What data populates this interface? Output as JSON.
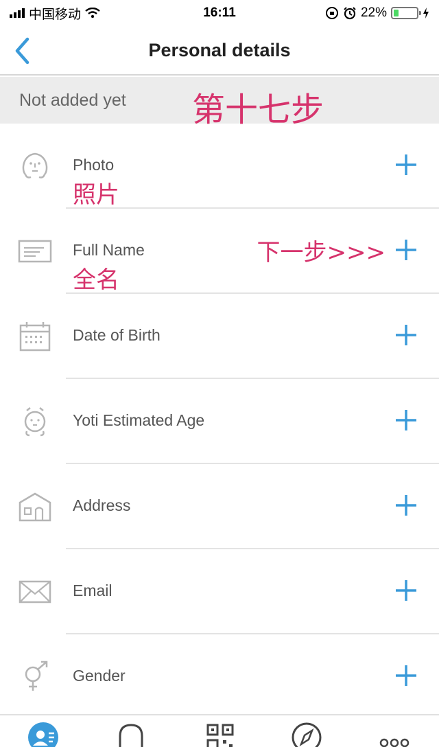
{
  "status_bar": {
    "carrier": "中国移动",
    "time": "16:11",
    "battery": "22%",
    "battery_level": 0.22,
    "icons": [
      "signal-icon",
      "wifi-icon",
      "rotation-lock-icon",
      "alarm-icon",
      "battery-icon",
      "charging-icon"
    ]
  },
  "nav": {
    "title": "Personal details",
    "back_icon": "chevron-left-icon"
  },
  "banner": {
    "text": "Not added yet",
    "annotation": "第十七步"
  },
  "rows": [
    {
      "label": "Photo",
      "icon": "face-icon",
      "annotation": "照片"
    },
    {
      "label": "Full Name",
      "icon": "id-card-icon",
      "annotation": "全名",
      "next_annotation": "下一步>>>"
    },
    {
      "label": "Date of Birth",
      "icon": "calendar-icon"
    },
    {
      "label": "Yoti Estimated Age",
      "icon": "age-face-icon"
    },
    {
      "label": "Address",
      "icon": "house-icon"
    },
    {
      "label": "Email",
      "icon": "envelope-icon"
    },
    {
      "label": "Gender",
      "icon": "gender-icon"
    }
  ],
  "tabs": [
    "profile-icon",
    "bell-icon",
    "qr-code-icon",
    "compass-icon",
    "more-icon"
  ],
  "colors": {
    "accent": "#3a9ad9",
    "annotation": "#d6336c",
    "banner_bg": "#ececec",
    "icon_grey": "#b5b5b5"
  }
}
